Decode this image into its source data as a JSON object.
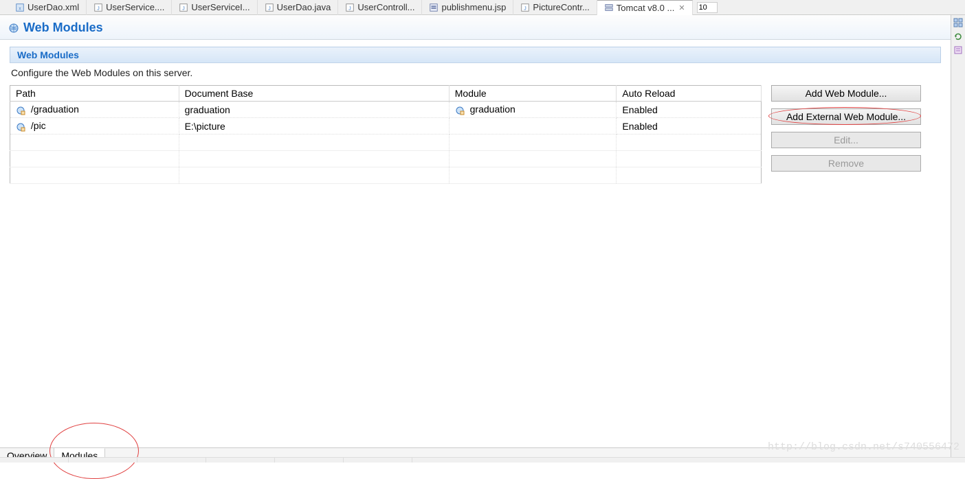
{
  "topTabs": [
    {
      "label": "UserDao.xml",
      "iconType": "xml"
    },
    {
      "label": "UserService....",
      "iconType": "java"
    },
    {
      "label": "UserServiceI...",
      "iconType": "java"
    },
    {
      "label": "UserDao.java",
      "iconType": "java"
    },
    {
      "label": "UserControll...",
      "iconType": "java"
    },
    {
      "label": "publishmenu.jsp",
      "iconType": "jsp"
    },
    {
      "label": "PictureContr...",
      "iconType": "java"
    },
    {
      "label": "Tomcat v8.0 ...",
      "iconType": "server",
      "active": true,
      "closable": true
    }
  ],
  "tabInputValue": "10",
  "section": {
    "title": "Web Modules",
    "contentHeader": "Web Modules",
    "description": "Configure the Web Modules on this server."
  },
  "table": {
    "columns": [
      "Path",
      "Document Base",
      "Module",
      "Auto Reload"
    ],
    "colWidths": [
      "245px",
      "392px",
      "243px",
      "210px"
    ],
    "rows": [
      {
        "path": "/graduation",
        "docBase": "graduation",
        "module": "graduation",
        "autoReload": "Enabled",
        "hasPathIcon": true,
        "hasModuleIcon": true
      },
      {
        "path": "/pic",
        "docBase": "E:\\picture",
        "module": "",
        "autoReload": "Enabled",
        "hasPathIcon": true,
        "hasModuleIcon": false
      }
    ]
  },
  "buttons": {
    "addWebModule": "Add Web Module...",
    "addExternal": "Add External Web Module...",
    "edit": "Edit...",
    "remove": "Remove"
  },
  "bottomTabs": [
    {
      "label": "Overview",
      "active": false
    },
    {
      "label": "Modules",
      "active": true
    }
  ],
  "watermark": "http://blog.csdn.net/s740556472"
}
